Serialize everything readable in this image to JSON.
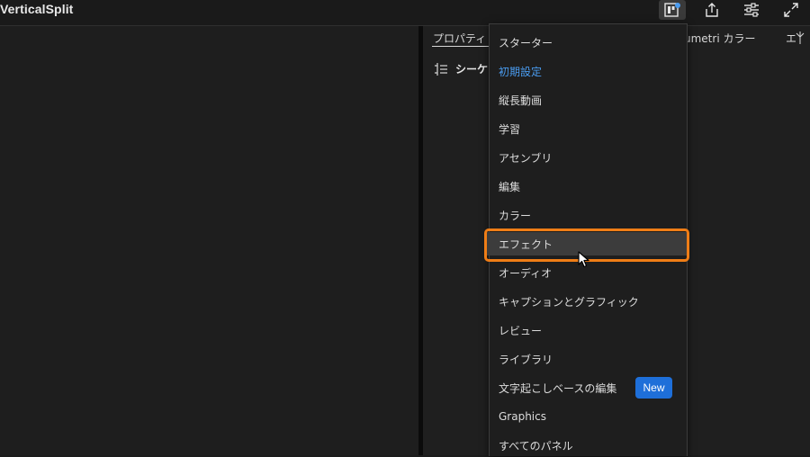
{
  "app": {
    "title": "VerticalSplit"
  },
  "toolbar": {
    "buttons": [
      {
        "name": "workspaces-icon"
      },
      {
        "name": "share-icon"
      },
      {
        "name": "panel-options-icon"
      },
      {
        "name": "fullscreen-icon"
      }
    ]
  },
  "right_panel": {
    "tabs": {
      "properties": "プロパティ",
      "lumetri": "umetri カラー",
      "effects": "エ"
    },
    "sequence_label": "シーケ"
  },
  "workspace_menu": {
    "items": [
      {
        "label": "スターター"
      },
      {
        "label": "初期設定",
        "selected": true
      },
      {
        "label": "縦長動画"
      },
      {
        "label": "学習"
      },
      {
        "label": "アセンブリ"
      },
      {
        "label": "編集"
      },
      {
        "label": "カラー"
      },
      {
        "label": "エフェクト",
        "hovered": true
      },
      {
        "label": "オーディオ"
      },
      {
        "label": "キャプションとグラフィック"
      },
      {
        "label": "レビュー"
      },
      {
        "label": "ライブラリ"
      },
      {
        "label": "文字起こしベースの編集",
        "badge": "New"
      },
      {
        "label": "Graphics"
      },
      {
        "label": "すべてのパネル"
      }
    ]
  },
  "colors": {
    "accent": "#4a9cf0",
    "highlight": "#ef7d16",
    "badge": "#1e6fd9"
  }
}
